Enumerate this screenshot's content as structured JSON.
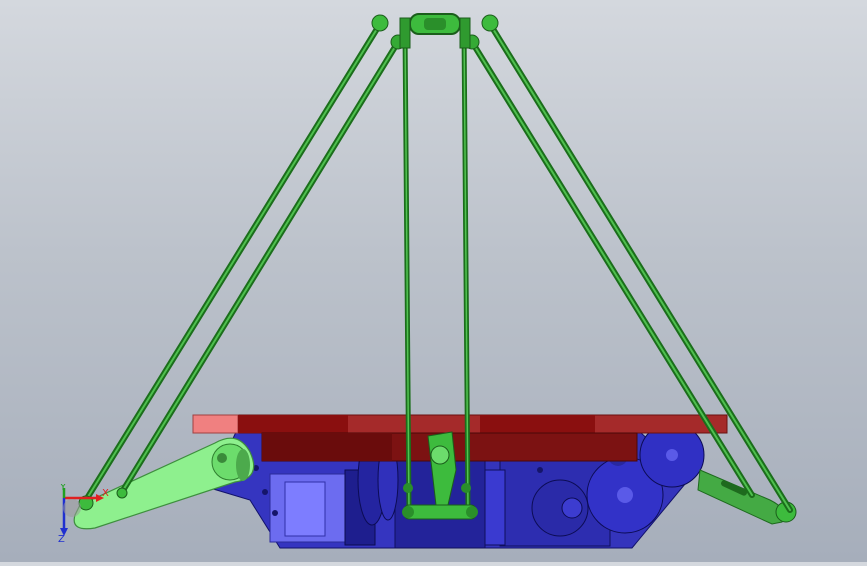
{
  "view": {
    "background": "#b8bfc9",
    "palette": {
      "rod": "#2f8f2f",
      "rod_dark": "#1b5e1b",
      "joint": "#3dbb3d",
      "arm_light": "#8ef08e",
      "plate_top": "#a52a2a",
      "plate_pink": "#f08080",
      "plate_dark": "#7a1010",
      "body_blue": "#3535c0",
      "body_dark": "#1a1a8a",
      "motor_blue": "#6a6aee"
    }
  },
  "triad": {
    "x_label": "X",
    "y_label": "Y",
    "z_label": "Z",
    "x_color": "#e02020",
    "y_color": "#20a020",
    "z_color": "#2030d0"
  }
}
